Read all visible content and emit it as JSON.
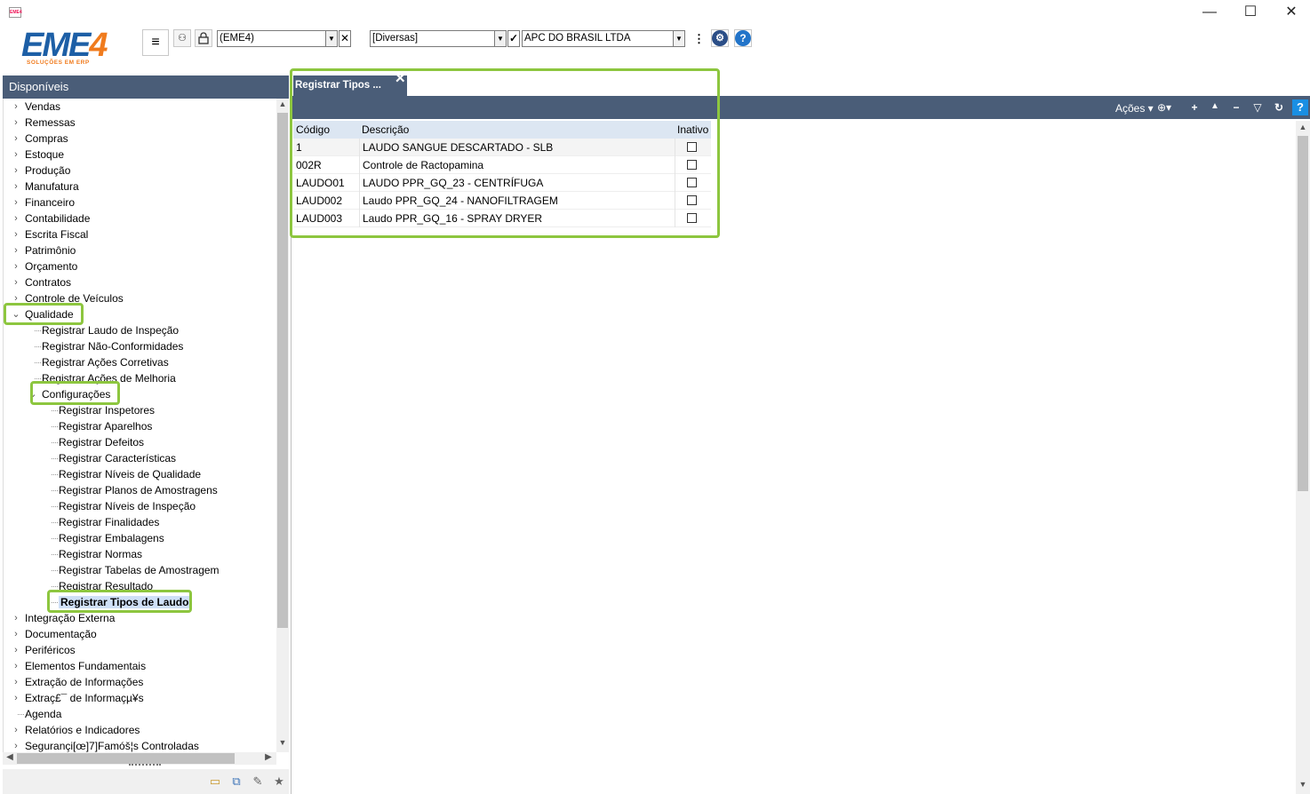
{
  "app": {
    "icon_text": "EME4"
  },
  "window": {
    "minimize": "—",
    "maximize": "☐",
    "close": "✕"
  },
  "logo": {
    "main": "EME",
    "digit": "4",
    "tagline": "SOLUÇÕES EM ERP"
  },
  "toolbar": {
    "menu_glyph": "≡",
    "database_combo": "(EME4)",
    "category_combo": "[Diversas]",
    "company_combo": "APC DO BRASIL LTDA",
    "clear_glyph": "✕",
    "more_glyph": "⋮",
    "confirm_glyph": "✓",
    "settings_glyph": "⚙",
    "help_glyph": "?",
    "people_glyph": "⚇",
    "lock_glyph": "🔒"
  },
  "left_panel": {
    "header": "Disponíveis",
    "tree": [
      {
        "label": "Vendas",
        "level": 0,
        "state": "collapsed"
      },
      {
        "label": "Remessas",
        "level": 0,
        "state": "collapsed"
      },
      {
        "label": "Compras",
        "level": 0,
        "state": "collapsed"
      },
      {
        "label": "Estoque",
        "level": 0,
        "state": "collapsed"
      },
      {
        "label": "Produção",
        "level": 0,
        "state": "collapsed"
      },
      {
        "label": "Manufatura",
        "level": 0,
        "state": "collapsed"
      },
      {
        "label": "Financeiro",
        "level": 0,
        "state": "collapsed"
      },
      {
        "label": "Contabilidade",
        "level": 0,
        "state": "collapsed"
      },
      {
        "label": "Escrita Fiscal",
        "level": 0,
        "state": "collapsed"
      },
      {
        "label": "Patrimônio",
        "level": 0,
        "state": "collapsed"
      },
      {
        "label": "Orçamento",
        "level": 0,
        "state": "collapsed"
      },
      {
        "label": "Contratos",
        "level": 0,
        "state": "collapsed"
      },
      {
        "label": "Controle de Veículos",
        "level": 0,
        "state": "collapsed"
      },
      {
        "label": "Qualidade",
        "level": 0,
        "state": "expanded"
      },
      {
        "label": "Registrar Laudo de Inspeção",
        "level": 1,
        "state": "leaf"
      },
      {
        "label": "Registrar Não-Conformidades",
        "level": 1,
        "state": "leaf"
      },
      {
        "label": "Registrar Ações Corretivas",
        "level": 1,
        "state": "leaf"
      },
      {
        "label": "Registrar Ações de Melhoria",
        "level": 1,
        "state": "leaf"
      },
      {
        "label": "Configurações",
        "level": 1,
        "state": "expanded"
      },
      {
        "label": "Registrar Inspetores",
        "level": 2,
        "state": "leaf"
      },
      {
        "label": "Registrar Aparelhos",
        "level": 2,
        "state": "leaf"
      },
      {
        "label": "Registrar Defeitos",
        "level": 2,
        "state": "leaf"
      },
      {
        "label": "Registrar Características",
        "level": 2,
        "state": "leaf"
      },
      {
        "label": "Registrar Níveis de Qualidade",
        "level": 2,
        "state": "leaf"
      },
      {
        "label": "Registrar Planos de Amostragens",
        "level": 2,
        "state": "leaf"
      },
      {
        "label": "Registrar Níveis de Inspeção",
        "level": 2,
        "state": "leaf"
      },
      {
        "label": "Registrar Finalidades",
        "level": 2,
        "state": "leaf"
      },
      {
        "label": "Registrar Embalagens",
        "level": 2,
        "state": "leaf"
      },
      {
        "label": "Registrar Normas",
        "level": 2,
        "state": "leaf"
      },
      {
        "label": "Registrar Tabelas de Amostragem",
        "level": 2,
        "state": "leaf"
      },
      {
        "label": "Registrar Resultado",
        "level": 2,
        "state": "leaf"
      },
      {
        "label": "Registrar Tipos de Laudo",
        "level": 2,
        "state": "selected"
      },
      {
        "label": "Integração Externa",
        "level": 0,
        "state": "collapsed"
      },
      {
        "label": "Documentação",
        "level": 0,
        "state": "collapsed"
      },
      {
        "label": "Periféricos",
        "level": 0,
        "state": "collapsed"
      },
      {
        "label": "Elementos Fundamentais",
        "level": 0,
        "state": "collapsed"
      },
      {
        "label": "Extração de Informações",
        "level": 0,
        "state": "collapsed"
      },
      {
        "label": "Extraç£¯ de Informaçµ¥s",
        "level": 0,
        "state": "collapsed"
      },
      {
        "label": "Agenda",
        "level": 0,
        "state": "leaf"
      },
      {
        "label": "Relatórios e Indicadores",
        "level": 0,
        "state": "collapsed"
      },
      {
        "label": "Segurançi[œ]7]Famóš¦s Controladas",
        "level": 0,
        "state": "collapsed"
      }
    ],
    "footer_icons": [
      "folder-open-icon",
      "copy-icon",
      "edit-icon",
      "star-icon"
    ]
  },
  "tab": {
    "label": "Registrar Tipos ...",
    "close": "✕"
  },
  "actions": {
    "label": "Ações ▾",
    "icons": [
      "⊕▾",
      "+",
      "▲",
      "−",
      "▽",
      "↻"
    ]
  },
  "grid": {
    "columns": [
      "Código",
      "Descrição",
      "Inativo"
    ],
    "rows": [
      {
        "codigo": "1",
        "descricao": "LAUDO SANGUE DESCARTADO - SLB",
        "inativo": false
      },
      {
        "codigo": "002R",
        "descricao": "Controle de Ractopamina",
        "inativo": false
      },
      {
        "codigo": "LAUDO01",
        "descricao": "LAUDO PPR_GQ_23 - CENTRÍFUGA",
        "inativo": false
      },
      {
        "codigo": "LAUD002",
        "descricao": "Laudo PPR_GQ_24 - NANOFILTRAGEM",
        "inativo": false
      },
      {
        "codigo": "LAUD003",
        "descricao": "Laudo PPR_GQ_16 - SPRAY DRYER",
        "inativo": false
      }
    ]
  },
  "colors": {
    "header_bg": "#4a5d78",
    "highlight": "#8dc63f",
    "grid_header": "#dce6f2",
    "selected": "#cfe0f7"
  }
}
